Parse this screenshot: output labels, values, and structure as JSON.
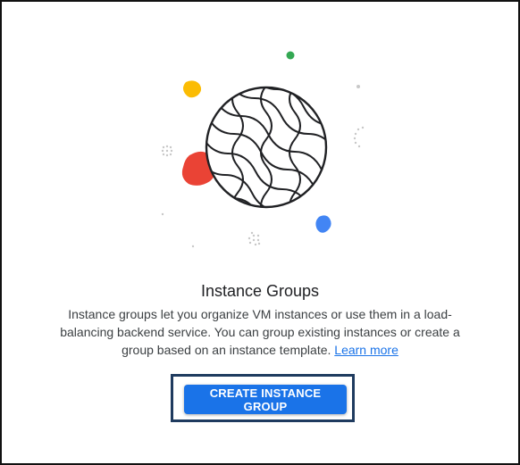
{
  "empty_state": {
    "title": "Instance Groups",
    "description": "Instance groups let you organize VM instances or use them in a load-balancing backend service. You can group existing instances or create a group based on an instance template.",
    "learn_more_label": "Learn more",
    "create_button_label": "CREATE INSTANCE GROUP"
  },
  "illustration": {
    "icon": "globe-illustration",
    "colors": {
      "red": "#ea4335",
      "yellow": "#fbbc04",
      "green": "#34a853",
      "blue": "#4285f4",
      "outline": "#202124"
    }
  },
  "theme": {
    "accent": "#1a73e8",
    "highlight_border": "#1f3b5f"
  }
}
